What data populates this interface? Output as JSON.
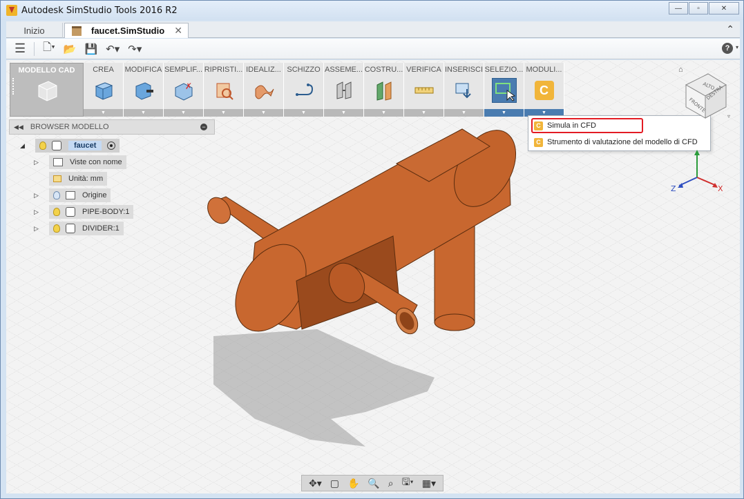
{
  "window": {
    "title": "Autodesk SimStudio Tools 2016 R2",
    "controls": {
      "minimize": "—",
      "maximize": "▫",
      "close": "✕"
    }
  },
  "tabs": [
    {
      "label": "Inizio",
      "active": false
    },
    {
      "label": "faucet.SimStudio",
      "active": true,
      "close": "✕"
    }
  ],
  "ribbon": {
    "workspace": "MODELLO CAD",
    "groups": [
      {
        "label": "CREA",
        "icon": "box-icon"
      },
      {
        "label": "MODIFICA",
        "icon": "modify-icon"
      },
      {
        "label": "SEMPLIF...",
        "icon": "simplify-icon"
      },
      {
        "label": "RIPRISTI...",
        "icon": "restore-icon"
      },
      {
        "label": "IDEALIZ...",
        "icon": "idealize-icon"
      },
      {
        "label": "SCHIZZO",
        "icon": "sketch-icon"
      },
      {
        "label": "ASSEME...",
        "icon": "assemble-icon"
      },
      {
        "label": "COSTRU...",
        "icon": "construct-icon"
      },
      {
        "label": "VERIFICA",
        "icon": "measure-icon"
      },
      {
        "label": "INSERISCI",
        "icon": "insert-icon"
      },
      {
        "label": "SELEZIO...",
        "icon": "select-icon"
      },
      {
        "label": "MODULI...",
        "icon": "cfd-icon"
      }
    ]
  },
  "dropdown": {
    "items": [
      {
        "label": "Simula in CFD",
        "highlighted": true
      },
      {
        "label": "Strumento di valutazione del modello di CFD",
        "highlighted": false
      }
    ],
    "icon_letter": "C"
  },
  "browser": {
    "title": "BROWSER MODELLO",
    "root": "faucet",
    "items": [
      {
        "label": "Viste con nome"
      },
      {
        "label": "Unità: mm"
      },
      {
        "label": "Origine"
      },
      {
        "label": "PIPE-BODY:1"
      },
      {
        "label": "DIVIDER:1"
      }
    ]
  },
  "viewcube": {
    "top": "ALTO",
    "front": "FRONTE",
    "right": "DESTRA"
  },
  "axes": {
    "x": "X",
    "z": "Z"
  },
  "colors": {
    "model": "#c8672f",
    "highlight_border": "#e31b23",
    "cfd_icon": "#f1b53a",
    "select_blue": "#4a7cb0"
  }
}
